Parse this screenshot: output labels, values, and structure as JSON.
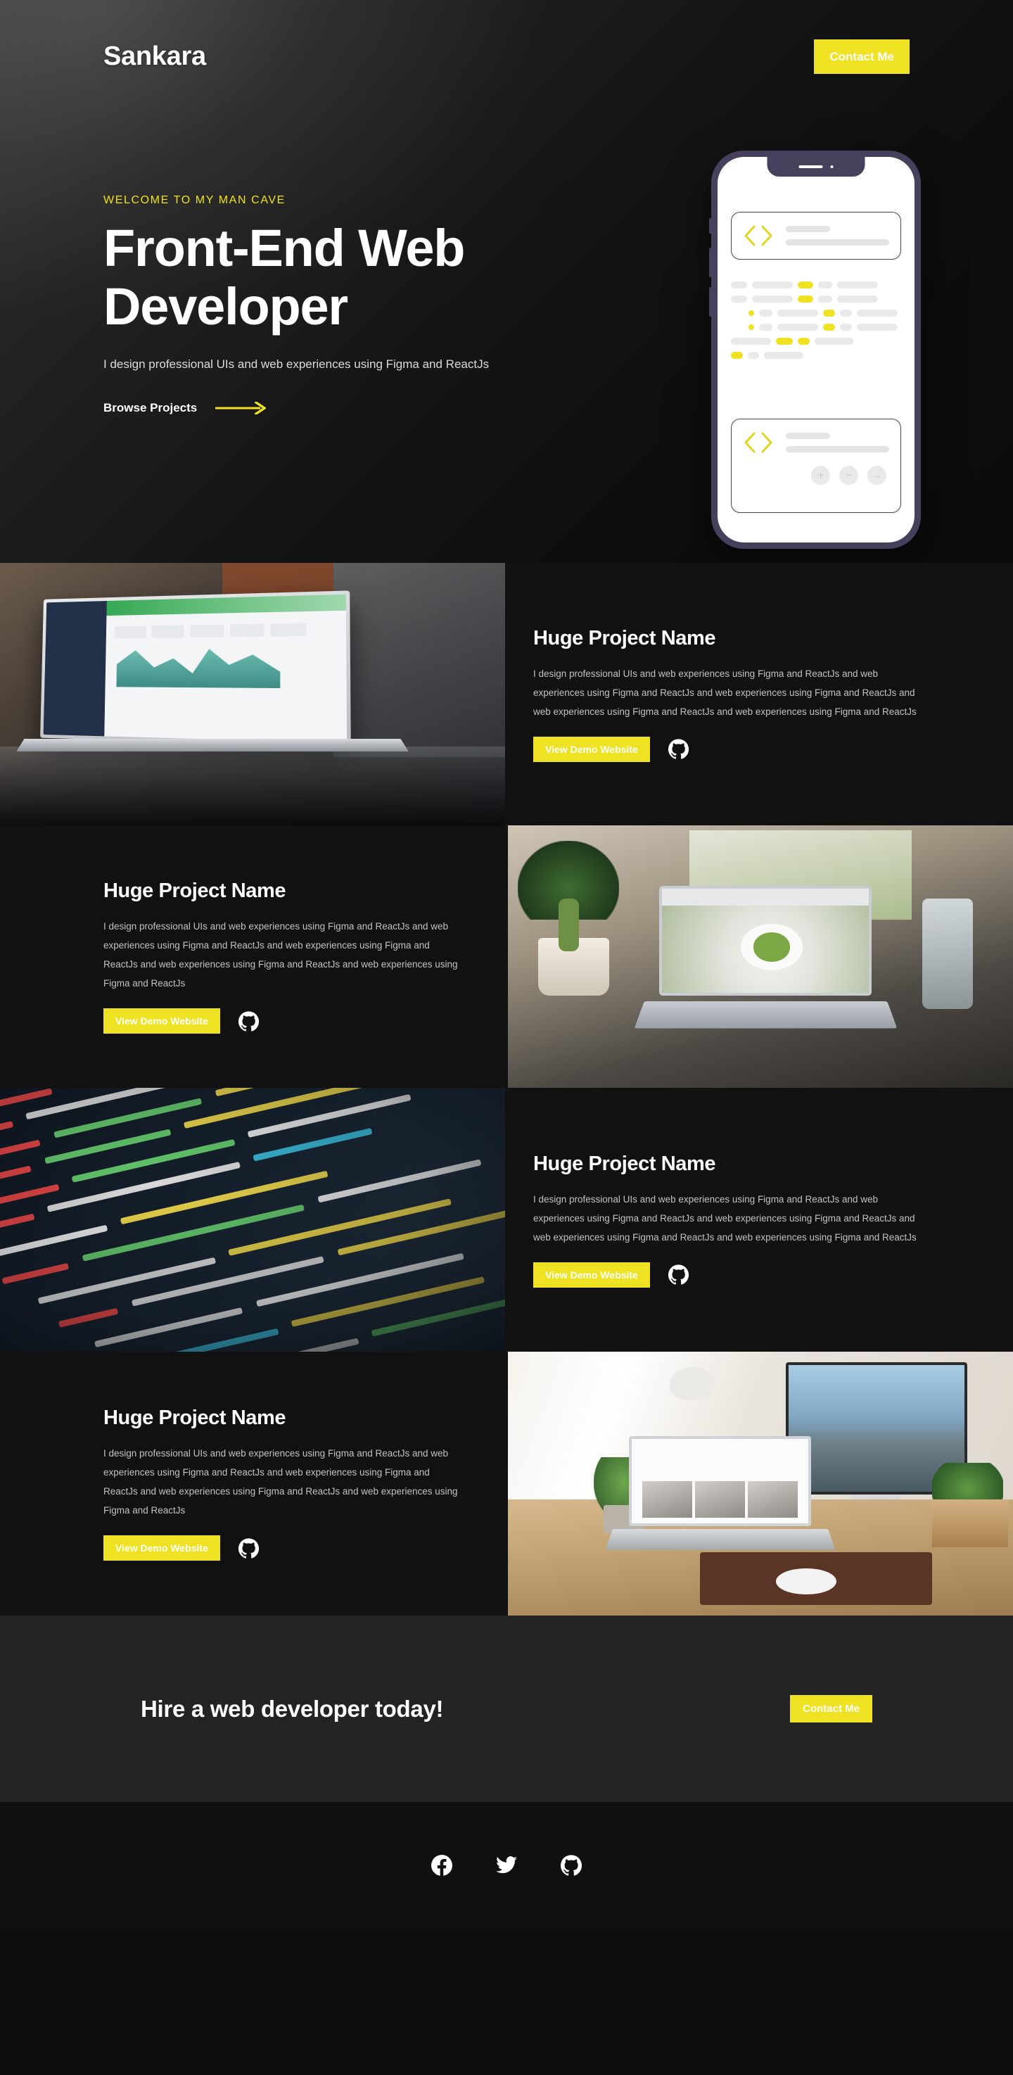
{
  "meta": {
    "accent_yellow": "#EFE222",
    "bg_dark": "#111111",
    "bg_cta": "#232323",
    "bg_footer": "#101010",
    "phone_frame": "#46405c"
  },
  "nav": {
    "brand": "Sankara",
    "contact_label": "Contact Me"
  },
  "hero": {
    "eyebrow": "WELCOME TO MY MAN CAVE",
    "title": "Front-End Web Developer",
    "subtitle": "I design professional UIs and web experiences using Figma and ReactJs",
    "browse_label": "Browse Projects",
    "arrow_icon": "arrow-right-icon"
  },
  "phone_mockup": {
    "code_icon": "code-brackets-icon",
    "buttons": [
      "+",
      "−",
      "→"
    ]
  },
  "projects": [
    {
      "title": "Huge Project Name",
      "description": "I design professional UIs and web experiences using Figma and ReactJs and web experiences using Figma and ReactJs and web experiences using Figma and ReactJs and web experiences using Figma and ReactJs and web experiences using Figma and ReactJs",
      "demo_label": "View Demo Website",
      "github_icon": "github-icon",
      "image_alt": "laptop showing analytics dashboard on glass desk",
      "image_side": "left"
    },
    {
      "title": "Huge Project Name",
      "description": "I design professional UIs and web experiences using Figma and ReactJs and web experiences using Figma and ReactJs and web experiences using Figma and ReactJs and web experiences using Figma and ReactJs and web experiences using Figma and ReactJs",
      "demo_label": "View Demo Website",
      "github_icon": "github-icon",
      "image_alt": "macbook pro showing food recipe website with cactus",
      "image_side": "right"
    },
    {
      "title": "Huge Project Name",
      "description": "I design professional UIs and web experiences using Figma and ReactJs and web experiences using Figma and ReactJs and web experiences using Figma and ReactJs and web experiences using Figma and ReactJs and web experiences using Figma and ReactJs",
      "demo_label": "View Demo Website",
      "github_icon": "github-icon",
      "image_alt": "angled monitor showing colorful php source code",
      "image_side": "left"
    },
    {
      "title": "Huge Project Name",
      "description": "I design professional UIs and web experiences using Figma and ReactJs and web experiences using Figma and ReactJs and web experiences using Figma and ReactJs and web experiences using Figma and ReactJs and web experiences using Figma and ReactJs",
      "demo_label": "View Demo Website",
      "github_icon": "github-icon",
      "image_alt": "desk with imac laptop lamp and plants",
      "image_side": "right"
    }
  ],
  "cta": {
    "title": "Hire a web developer today!",
    "contact_label": "Contact Me"
  },
  "footer": {
    "socials": [
      {
        "name": "facebook-icon"
      },
      {
        "name": "twitter-icon"
      },
      {
        "name": "github-icon"
      }
    ]
  }
}
